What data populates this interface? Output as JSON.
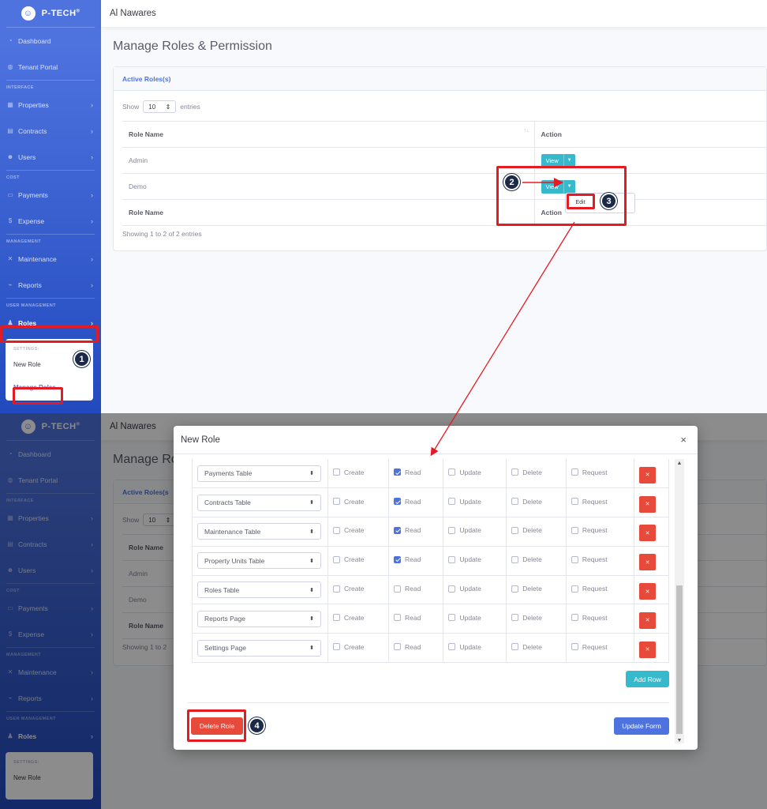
{
  "brand": {
    "name": "P-TECH",
    "mark": "®"
  },
  "topbar": {
    "title": "Al Nawares"
  },
  "sidebar": {
    "dashboard": "Dashboard",
    "tenant_portal": "Tenant Portal",
    "head_interface": "INTERFACE",
    "properties": "Properties",
    "contracts": "Contracts",
    "users": "Users",
    "head_cost": "COST",
    "payments": "Payments",
    "expense": "Expense",
    "head_management": "MANAGEMENT",
    "maintenance": "Maintenance",
    "reports": "Reports",
    "head_user_mgmt": "USER MANAGEMENT",
    "roles": "Roles",
    "submenu": {
      "head": "SETTINGS:",
      "new_role": "New Role",
      "manage_roles": "Manage Roles"
    }
  },
  "page": {
    "title": "Manage Roles & Permission",
    "card_title": "Active Roles(s)",
    "show": "Show",
    "entries_value": "10",
    "entries": "entries",
    "col_role": "Role Name",
    "col_action": "Action",
    "rows": [
      {
        "name": "Admin",
        "action": "View"
      },
      {
        "name": "Demo",
        "action": "View"
      }
    ],
    "dropdown_edit": "Edit",
    "showing": "Showing 1 to 2 of 2 entries"
  },
  "steps": {
    "s1": "1",
    "s2": "2",
    "s3": "3",
    "s4": "4"
  },
  "modal": {
    "title": "New Role",
    "close": "×",
    "labels": {
      "create": "Create",
      "read": "Read",
      "update": "Update",
      "delete": "Delete",
      "request": "Request"
    },
    "rows": [
      {
        "table": "Payments Table",
        "read": true
      },
      {
        "table": "Contracts Table",
        "read": true
      },
      {
        "table": "Maintenance Table",
        "read": true
      },
      {
        "table": "Property Units Table",
        "read": true
      },
      {
        "table": "Roles Table",
        "read": false
      },
      {
        "table": "Reports Page",
        "read": false
      },
      {
        "table": "Settings Page",
        "read": false
      }
    ],
    "add_row": "Add Row",
    "delete_role": "Delete Role",
    "update_form": "Update Form"
  },
  "bottom_page": {
    "title": "Manage Ro",
    "card_title": "Active Roles(s",
    "show": "Show",
    "entries_value": "10",
    "col_role": "Role Name",
    "rows": [
      "Admin",
      "Demo"
    ],
    "foot": "Role Name",
    "showing": "Showing 1 to 2"
  },
  "colors": {
    "primary": "#4e73df",
    "info": "#36b9cc",
    "danger": "#e74a3b",
    "highlight": "#e31b23",
    "badge": "#1c2a48"
  },
  "icons": [
    "dashboard-icon",
    "portal-icon",
    "building-icon",
    "document-icon",
    "users-icon",
    "money-icon",
    "dollar-icon",
    "tools-icon",
    "chart-icon",
    "user-cog-icon",
    "chevron-right-icon"
  ]
}
